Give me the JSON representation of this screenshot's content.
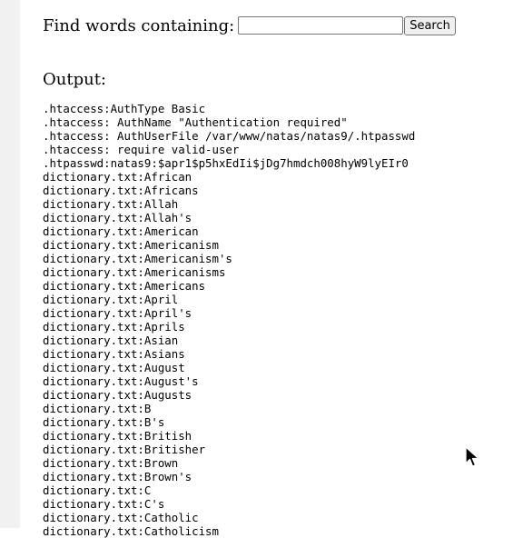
{
  "search": {
    "label": "Find words containing:",
    "input_value": "",
    "button_label": "Search"
  },
  "output": {
    "heading": "Output:",
    "lines": [
      ".htaccess:AuthType Basic",
      ".htaccess: AuthName \"Authentication required\"",
      ".htaccess: AuthUserFile /var/www/natas/natas9/.htpasswd",
      ".htaccess: require valid-user",
      ".htpasswd:natas9:$apr1$p5hxEdIi$jDg7hmdch008hyW9lyEIr0",
      "dictionary.txt:African",
      "dictionary.txt:Africans",
      "dictionary.txt:Allah",
      "dictionary.txt:Allah's",
      "dictionary.txt:American",
      "dictionary.txt:Americanism",
      "dictionary.txt:Americanism's",
      "dictionary.txt:Americanisms",
      "dictionary.txt:Americans",
      "dictionary.txt:April",
      "dictionary.txt:April's",
      "dictionary.txt:Aprils",
      "dictionary.txt:Asian",
      "dictionary.txt:Asians",
      "dictionary.txt:August",
      "dictionary.txt:August's",
      "dictionary.txt:Augusts",
      "dictionary.txt:B",
      "dictionary.txt:B's",
      "dictionary.txt:British",
      "dictionary.txt:Britisher",
      "dictionary.txt:Brown",
      "dictionary.txt:Brown's",
      "dictionary.txt:C",
      "dictionary.txt:C's",
      "dictionary.txt:Catholic",
      "dictionary.txt:Catholicism"
    ]
  },
  "icons": {
    "cursor": "mouse-pointer-icon"
  }
}
